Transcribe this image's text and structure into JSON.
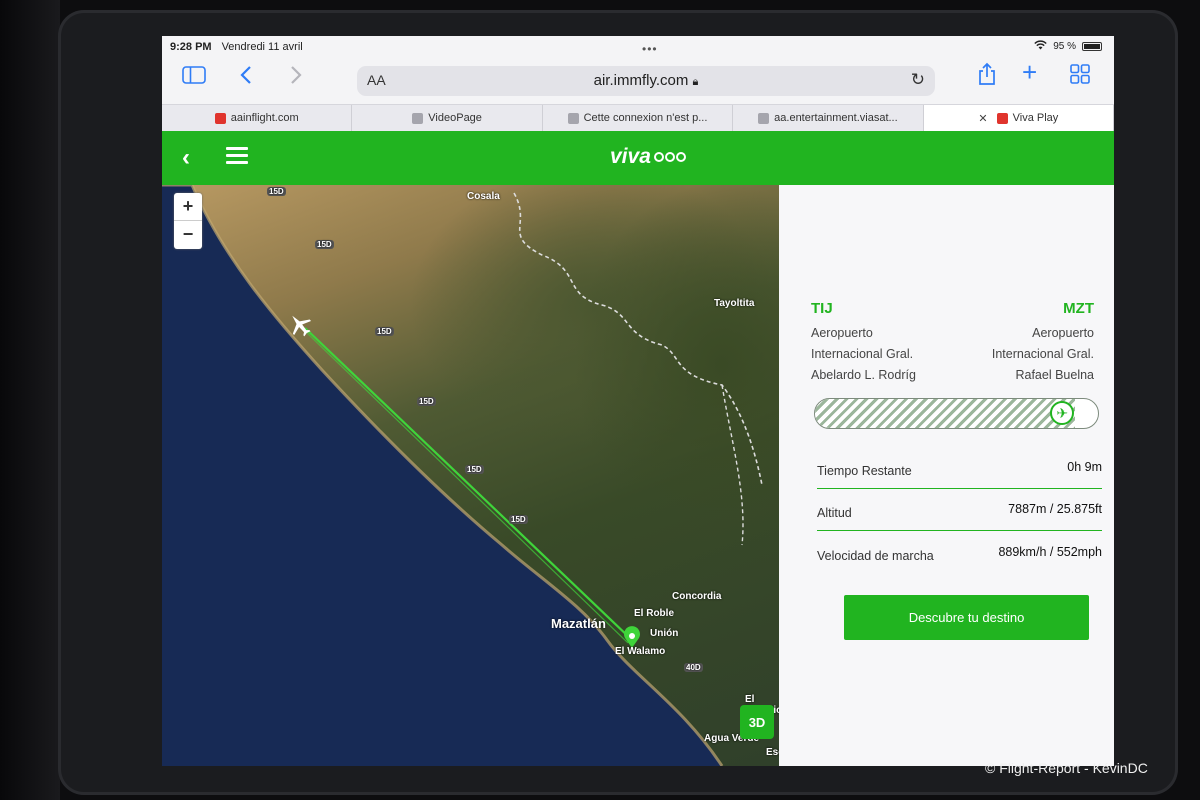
{
  "status": {
    "time": "9:28 PM",
    "date": "Vendredi 11 avril",
    "battery": "95 %"
  },
  "browser": {
    "url_aa": "AA",
    "url": "air.immfly.com",
    "tabs": [
      {
        "label": "aainflight.com"
      },
      {
        "label": "VideoPage"
      },
      {
        "label": "Cette connexion n'est p..."
      },
      {
        "label": "aa.entertainment.viasat..."
      },
      {
        "label": "Viva Play"
      }
    ]
  },
  "header": {
    "logo": "viva"
  },
  "map": {
    "zoom_in": "+",
    "zoom_out": "−",
    "places": [
      "Cosala",
      "Tayoltita",
      "Concordia",
      "El Roble",
      "Unión",
      "El Walamo",
      "Mazatlán",
      "El Rosario",
      "Agua Verde",
      "Escu"
    ],
    "highways": [
      "15D",
      "15D",
      "15D",
      "15D",
      "15D",
      "15D",
      "40D"
    ],
    "button_3d": "3D"
  },
  "flight": {
    "origin": {
      "code": "TIJ",
      "name_lines": [
        "Aeropuerto",
        "Internacional Gral.",
        "Abelardo L. Rodríg"
      ]
    },
    "destination": {
      "code": "MZT",
      "name_lines": [
        "Aeropuerto",
        "Internacional Gral.",
        "Rafael Buelna"
      ]
    },
    "progress_fraction": 0.92,
    "stats": [
      {
        "label": "Tiempo Restante",
        "value": "0h 9m"
      },
      {
        "label": "Altitud",
        "value": "7887m / 25.875ft"
      },
      {
        "label": "Velocidad de marcha",
        "value": "889km/h / 552mph"
      }
    ],
    "cta": "Descubre tu destino"
  },
  "colors": {
    "brand_green": "#21b420",
    "sea": "#172a55"
  },
  "credit": "© Flight-Report - KévinDC"
}
